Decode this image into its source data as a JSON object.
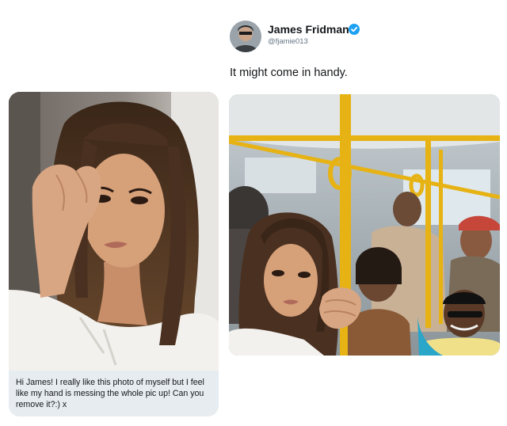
{
  "tweet": {
    "display_name": "James Fridman",
    "handle": "@fjamie013",
    "text": "It might come in handy."
  },
  "request": {
    "message": "Hi James! I really like this photo of myself but I feel like my hand is messing the whole pic up! Can you remove it?:) x"
  },
  "colors": {
    "verified_blue": "#1da1f2",
    "message_bg": "#e6ecf0",
    "handle_gray": "#657786",
    "bus_pole_yellow": "#e6b214"
  },
  "icons": {
    "verified": "verified-badge-icon"
  }
}
